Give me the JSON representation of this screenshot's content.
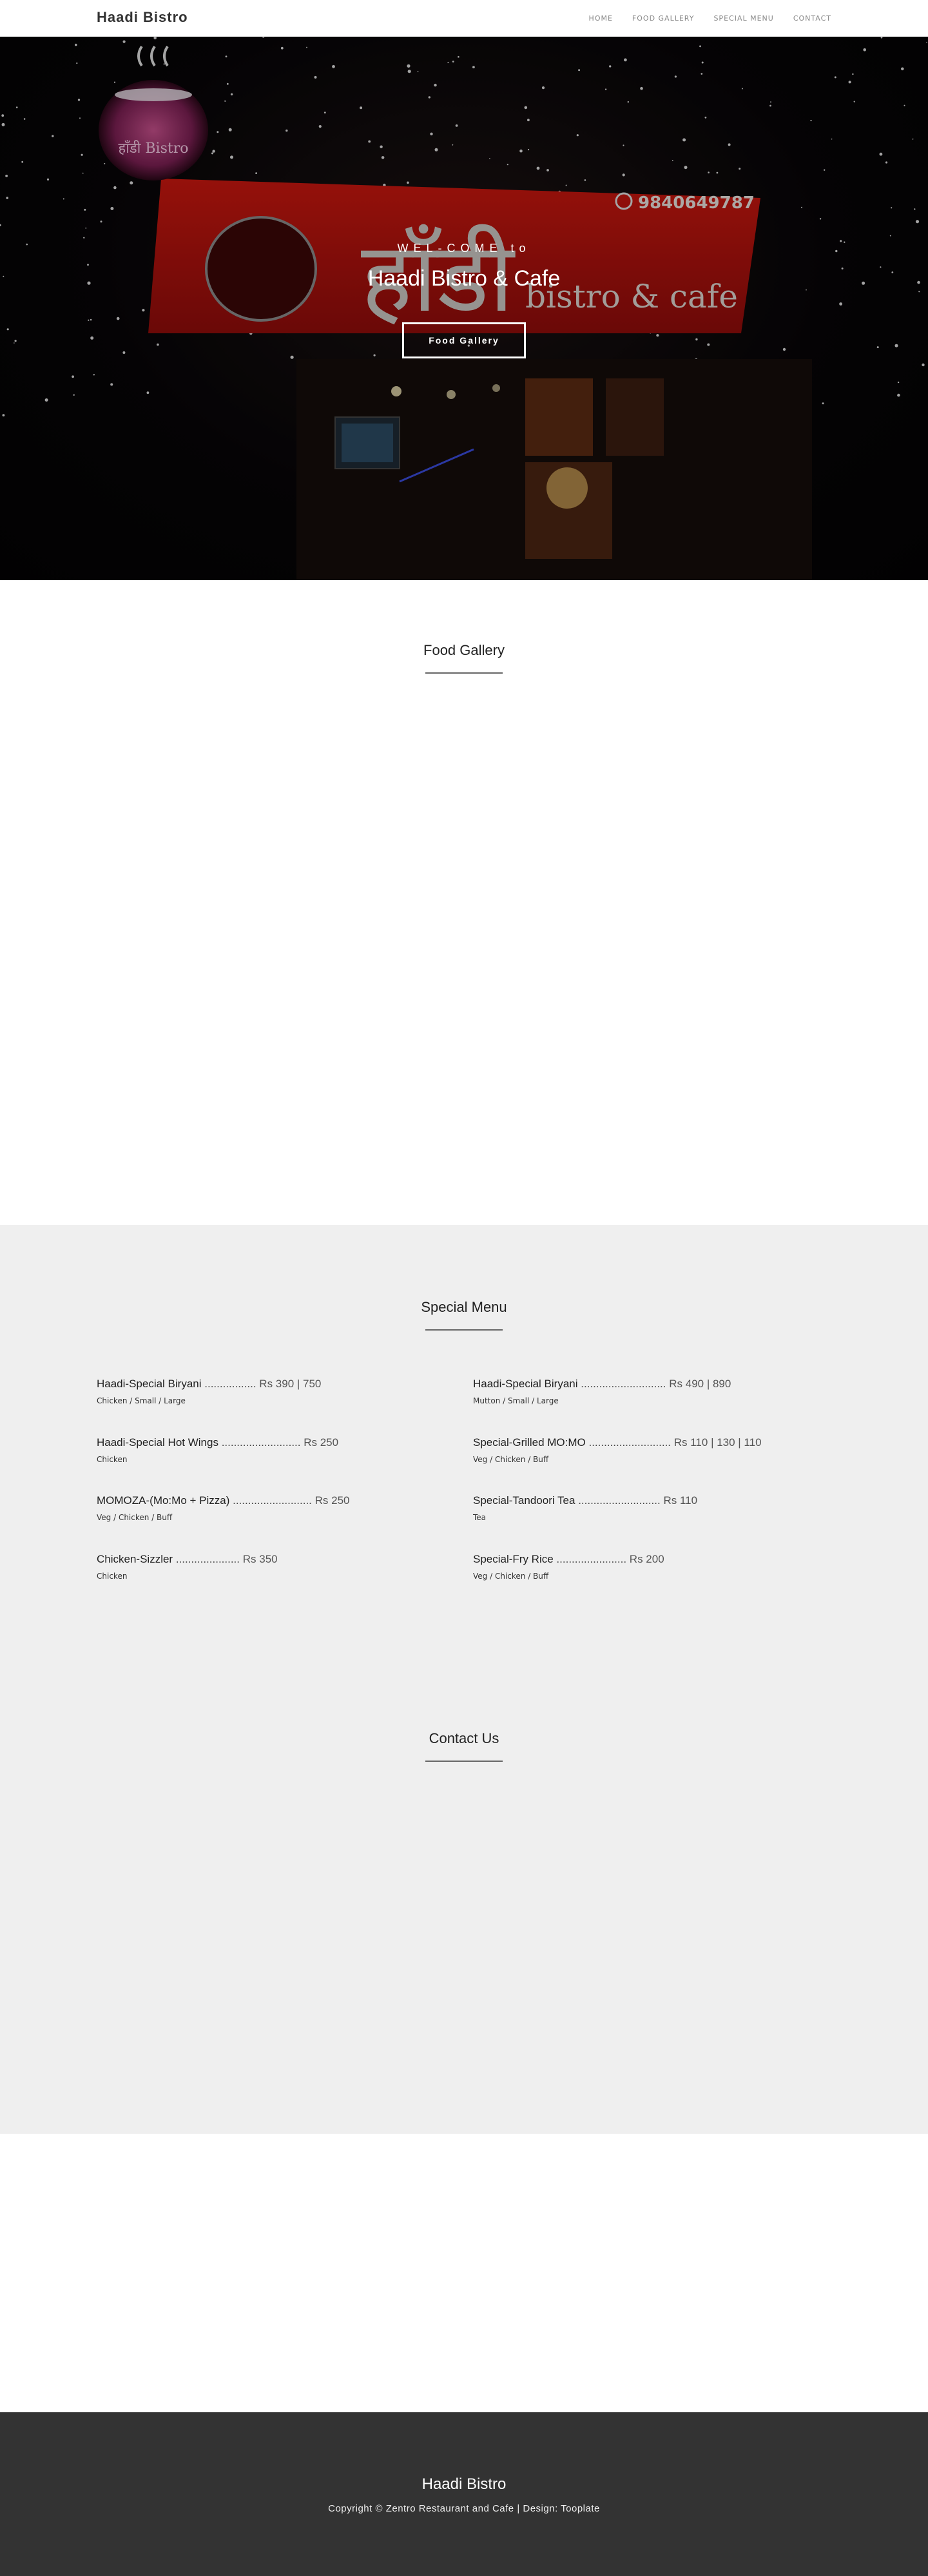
{
  "navbar": {
    "brand": "Haadi Bistro",
    "links": [
      "HOME",
      "FOOD GALLERY",
      "SPECIAL MENU",
      "CONTACT"
    ]
  },
  "hero": {
    "welcome": "WEL-COME to",
    "title": "Haadi Bistro & Cafe",
    "button_label": "Food Gallery",
    "sign_phone": "9840649787",
    "sign_script": "हाँडी",
    "sign_text": "bistro & cafe",
    "pot_label": "हाँडी Bistro"
  },
  "gallery": {
    "title": "Food Gallery"
  },
  "special_menu": {
    "title": "Special Menu",
    "items": [
      {
        "name": "Haadi-Special Biryani",
        "dots": " .................",
        "price": " Rs 390 | 750",
        "desc": "Chicken / Small / Large"
      },
      {
        "name": "Haadi-Special Biryani",
        "dots": " ............................",
        "price": " Rs 490 | 890",
        "desc": "Mutton / Small / Large"
      },
      {
        "name": "Haadi-Special Hot Wings",
        "dots": " ..........................",
        "price": " Rs 250",
        "desc": "Chicken"
      },
      {
        "name": "Special-Grilled MO:MO",
        "dots": " ...........................",
        "price": " Rs 110 | 130 | 110",
        "desc": "Veg / Chicken / Buff"
      },
      {
        "name": "MOMOZA-(Mo:Mo + Pizza)",
        "dots": " ..........................",
        "price": " Rs 250",
        "desc": "Veg / Chicken / Buff"
      },
      {
        "name": "Special-Tandoori Tea",
        "dots": " ...........................",
        "price": " Rs 110",
        "desc": "Tea"
      },
      {
        "name": "Chicken-Sizzler",
        "dots": " .....................",
        "price": " Rs 350",
        "desc": "Chicken"
      },
      {
        "name": "Special-Fry Rice",
        "dots": " .......................",
        "price": " Rs 200",
        "desc": "Veg / Chicken / Buff"
      }
    ]
  },
  "contact": {
    "title": "Contact Us"
  },
  "footer": {
    "brand": "Haadi Bistro",
    "copyright": "Copyright © Zentro Restaurant and Cafe | Design: Tooplate"
  },
  "colors": {
    "sign_red": "#b0120f",
    "footer_bg": "#333333",
    "menu_bg": "#efefef"
  }
}
